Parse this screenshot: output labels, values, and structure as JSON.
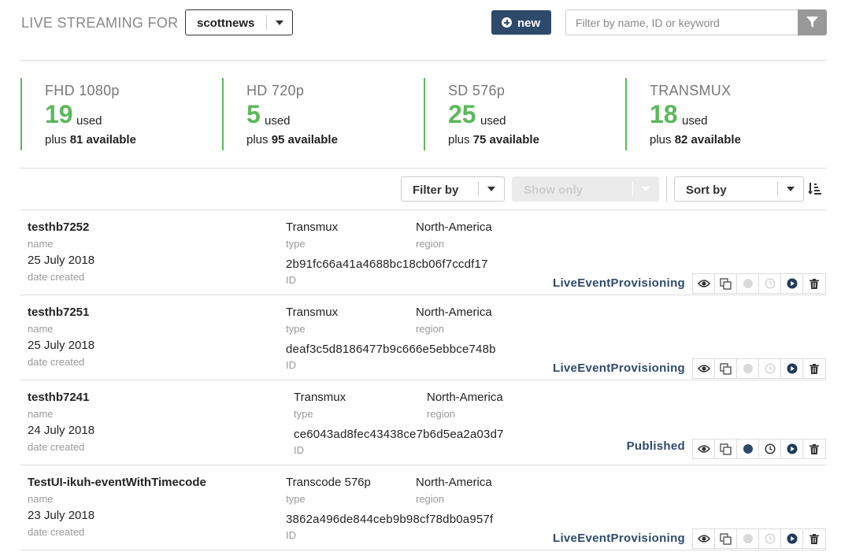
{
  "header": {
    "title": "LIVE STREAMING FOR",
    "account": "scottnews",
    "new_button": "new",
    "search_placeholder": "Filter by name, ID or keyword"
  },
  "stats": [
    {
      "name": "FHD 1080p",
      "used": "19",
      "used_label": "used",
      "plus": "plus",
      "available": "81 available"
    },
    {
      "name": "HD 720p",
      "used": "5",
      "used_label": "used",
      "plus": "plus",
      "available": "95 available"
    },
    {
      "name": "SD 576p",
      "used": "25",
      "used_label": "used",
      "plus": "plus",
      "available": "75 available"
    },
    {
      "name": "TRANSMUX",
      "used": "18",
      "used_label": "used",
      "plus": "plus",
      "available": "82 available"
    }
  ],
  "toolbar": {
    "filter_by": "Filter by",
    "show_only": "Show only",
    "sort_by": "Sort by"
  },
  "labels": {
    "name": "name",
    "date_created": "date created",
    "type": "type",
    "region": "region",
    "id": "ID"
  },
  "events": [
    {
      "name": "testhb7252",
      "date": "25 July 2018",
      "type": "Transmux",
      "region": "North-America",
      "id": "2b91fc66a41a4688bc18cb06f7ccdf17",
      "status": "LiveEventProvisioning",
      "active": false
    },
    {
      "name": "testhb7251",
      "date": "25 July 2018",
      "type": "Transmux",
      "region": "North-America",
      "id": "deaf3c5d8186477b9c666e5ebbce748b",
      "status": "LiveEventProvisioning",
      "active": false
    },
    {
      "name": "testhb7241",
      "date": "24 July 2018",
      "type": "Transmux",
      "region": "North-America",
      "id": "ce6043ad8fec43438ce7b6d5ea2a03d7",
      "status": "Published",
      "active": true
    },
    {
      "name": "TestUI-ikuh-eventWithTimecode",
      "date": "23 July 2018",
      "type": "Transcode 576p",
      "region": "North-America",
      "id": "3862a496de844ceb9b98cf78db0a957f",
      "status": "LiveEventProvisioning",
      "active": false
    }
  ],
  "icons": [
    "filter-icon",
    "plus-circle-icon",
    "sort-icon",
    "eye-icon",
    "copy-icon",
    "record-icon",
    "clock-icon",
    "play-icon",
    "trash-icon"
  ],
  "colors": {
    "accent": "#2e4a6b",
    "green": "#5cb85c",
    "disabled": "#cccccc"
  }
}
